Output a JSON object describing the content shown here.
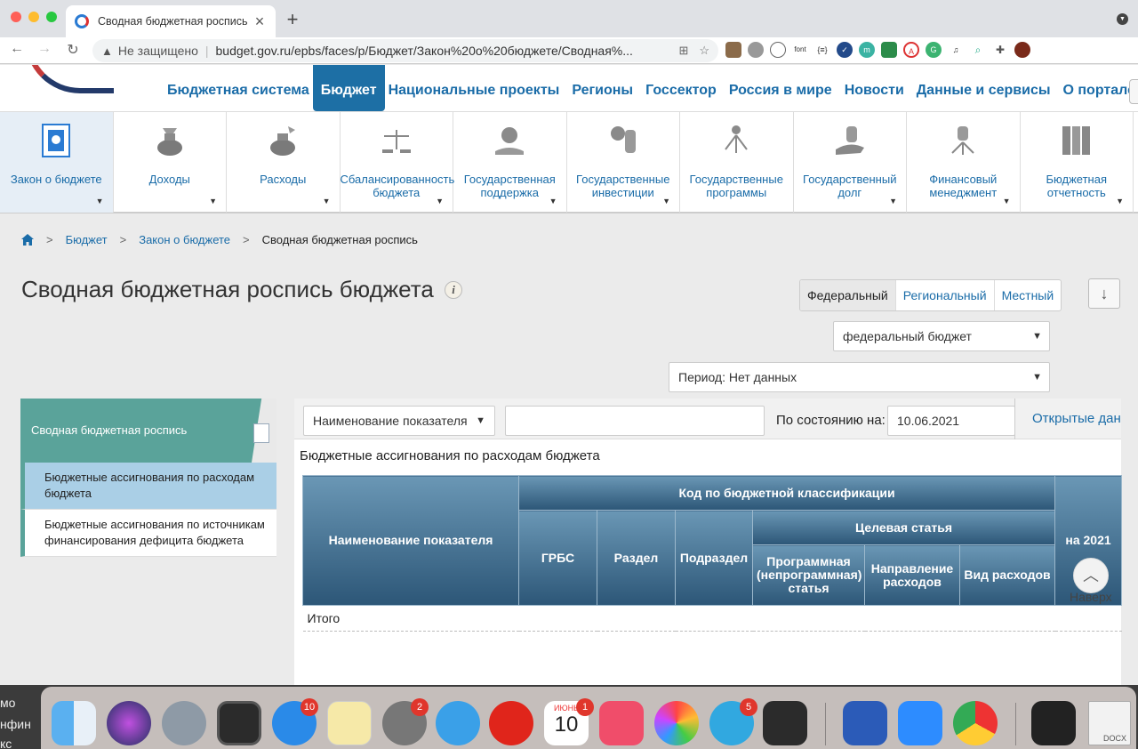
{
  "browser": {
    "tab_title": "Сводная бюджетная роспись",
    "new_tab": "+",
    "security_label": "Не защищено",
    "url": "budget.gov.ru/epbs/faces/p/Бюджет/Закон%20о%20бюджете/Сводная%..."
  },
  "header": {
    "nav": [
      "Бюджетная система",
      "Бюджет",
      "Национальные проекты",
      "Регионы",
      "Госсектор",
      "Россия в мире",
      "Новости",
      "Данные и сервисы",
      "О портале"
    ],
    "active_nav": "Бюджет"
  },
  "subnav": [
    {
      "label": "Закон о бюджете",
      "icon": "emblem-icon"
    },
    {
      "label": "Доходы",
      "icon": "money-bag-icon"
    },
    {
      "label": "Расходы",
      "icon": "money-bag-out-icon"
    },
    {
      "label": "Сбалансированность бюджета",
      "icon": "scales-icon"
    },
    {
      "label": "Государственная поддержка",
      "icon": "eagle-hands-icon"
    },
    {
      "label": "Государственные инвестиции",
      "icon": "coins-stack-icon"
    },
    {
      "label": "Государственные программы",
      "icon": "program-icon"
    },
    {
      "label": "Государственный долг",
      "icon": "hand-coins-icon"
    },
    {
      "label": "Финансовый менеджмент",
      "icon": "coins-arrows-icon"
    },
    {
      "label": "Бюджетная отчетность",
      "icon": "binders-icon"
    }
  ],
  "breadcrumb": {
    "items": [
      "Бюджет",
      "Закон о бюджете"
    ],
    "current": "Сводная бюджетная роспись",
    "separator": ">"
  },
  "page": {
    "title": "Сводная бюджетная роспись бюджета",
    "info": "i",
    "levels": [
      "Федеральный",
      "Региональный",
      "Местный"
    ],
    "selected_level": "Федеральный",
    "budget_select": "федеральный бюджет",
    "period_select": "Период: Нет данных",
    "download": "↓"
  },
  "sidebar": {
    "header": "Сводная бюджетная роспись",
    "items": [
      "Бюджетные ассигнования по расходам бюджета",
      "Бюджетные ассигнования по источникам финансирования дефицита бюджета"
    ]
  },
  "filters": {
    "field_select": "Наименование показателя",
    "search_value": "",
    "date_label": "По состоянию на:",
    "date_value": "10.06.2021",
    "open_data": "Открытые данные"
  },
  "table": {
    "caption": "Бюджетные ассигнования по расходам бюджета",
    "name_header": "Наименование показателя",
    "code_group": "Код по бюджетной классификации",
    "grbs": "ГРБС",
    "razdel": "Раздел",
    "podrazdel": "Подраздел",
    "target_group": "Целевая статья",
    "program": "Программная (непрограммная) статья",
    "direction": "Направление расходов",
    "vid": "Вид расходов",
    "year_col": "на 2021",
    "rows": [
      "Итого"
    ]
  },
  "to_top": "Наверх",
  "desktop_labels": [
    "мо",
    "нфин",
    "кс"
  ],
  "dock": {
    "badges": {
      "appstore": "10",
      "settings": "2",
      "calendar": "1",
      "telegram": "5"
    },
    "calendar_month": "ИЮНЬ",
    "calendar_day": "10",
    "docx_label": "DOCX"
  }
}
